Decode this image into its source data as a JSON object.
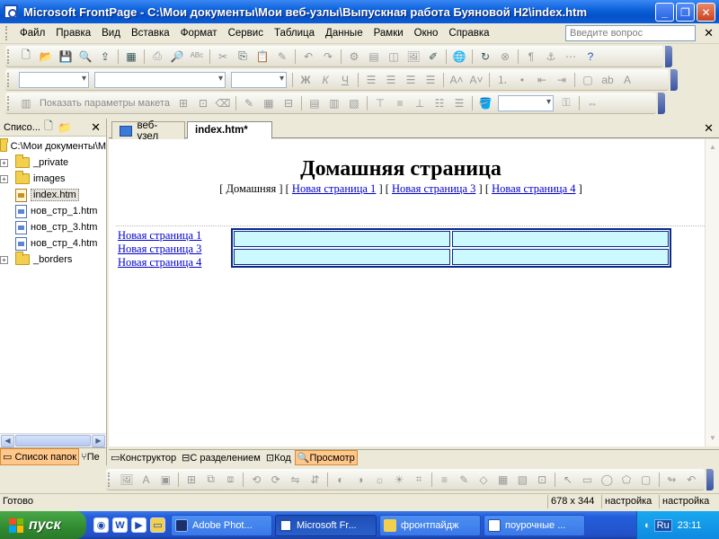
{
  "window": {
    "title": "Microsoft FrontPage - C:\\Мои документы\\Мои веб-узлы\\Выпускная работа Буяновой Н2\\index.htm"
  },
  "menu": {
    "items": [
      "Файл",
      "Правка",
      "Вид",
      "Вставка",
      "Формат",
      "Сервис",
      "Таблица",
      "Данные",
      "Рамки",
      "Окно",
      "Справка"
    ],
    "ask_placeholder": "Введите вопрос"
  },
  "toolbar3": {
    "layout_label": "Показать параметры макета"
  },
  "left_panel": {
    "title": "Списо...",
    "tree": [
      {
        "label": "C:\\Мои документы\\М"
      },
      {
        "label": "_private"
      },
      {
        "label": "images"
      },
      {
        "label": "index.htm"
      },
      {
        "label": "нов_стр_1.htm"
      },
      {
        "label": "нов_стр_3.htm"
      },
      {
        "label": "нов_стр_4.htm"
      },
      {
        "label": "_borders"
      }
    ],
    "tabs": [
      "Список папок",
      "Пе"
    ]
  },
  "doc_tabs": [
    "веб-узел",
    "index.htm*"
  ],
  "page": {
    "title": "Домашняя страница",
    "nav": {
      "current": "[ Домашняя ]",
      "links": [
        "Новая страница 1",
        "Новая страница 3",
        "Новая страница 4"
      ]
    },
    "side_links": [
      "Новая страница 1",
      "Новая страница 3",
      "Новая страница 4"
    ],
    "table": {
      "rows": 2,
      "cols": 2
    }
  },
  "view_tabs": [
    "Конструктор",
    "С разделением",
    "Код",
    "Просмотр"
  ],
  "status": {
    "text": "Готово",
    "size": "678 x 344",
    "mode1": "настройка",
    "mode2": "настройка"
  },
  "taskbar": {
    "start": "пуск",
    "tasks": [
      "Adobe Phot...",
      "Microsoft Fr...",
      "фронтпайдж",
      "поурочные ..."
    ],
    "lang": "Ru",
    "clock": "23:11"
  },
  "colors": {
    "accent": "#0a5fd8",
    "table_cell": "#ccf8ff",
    "link": "#0000cc",
    "active_tab": "#ffc78a"
  }
}
